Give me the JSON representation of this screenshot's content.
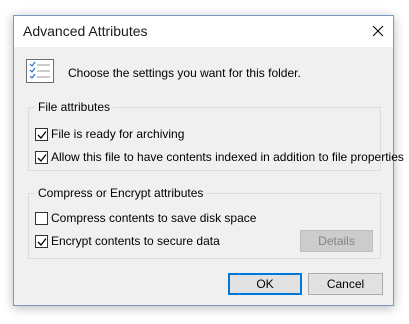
{
  "window": {
    "title": "Advanced Attributes",
    "close_icon": "close-icon"
  },
  "header": {
    "icon": "settings-list-icon",
    "text": "Choose the settings you want for this folder."
  },
  "file_attributes": {
    "label": "File attributes",
    "options": [
      {
        "label": "File is ready for archiving",
        "checked": true
      },
      {
        "label": "Allow this file to have contents indexed in addition to file properties",
        "checked": true
      }
    ]
  },
  "compress_encrypt": {
    "label": "Compress or Encrypt attributes",
    "options": [
      {
        "label": "Compress contents to save disk space",
        "checked": false
      },
      {
        "label": "Encrypt contents to secure data",
        "checked": true
      }
    ],
    "details_label": "Details",
    "details_enabled": false
  },
  "buttons": {
    "ok": "OK",
    "cancel": "Cancel"
  },
  "colors": {
    "dialog_bg": "#f0f0f0",
    "accent": "#0078d7",
    "disabled_text": "#838383"
  }
}
